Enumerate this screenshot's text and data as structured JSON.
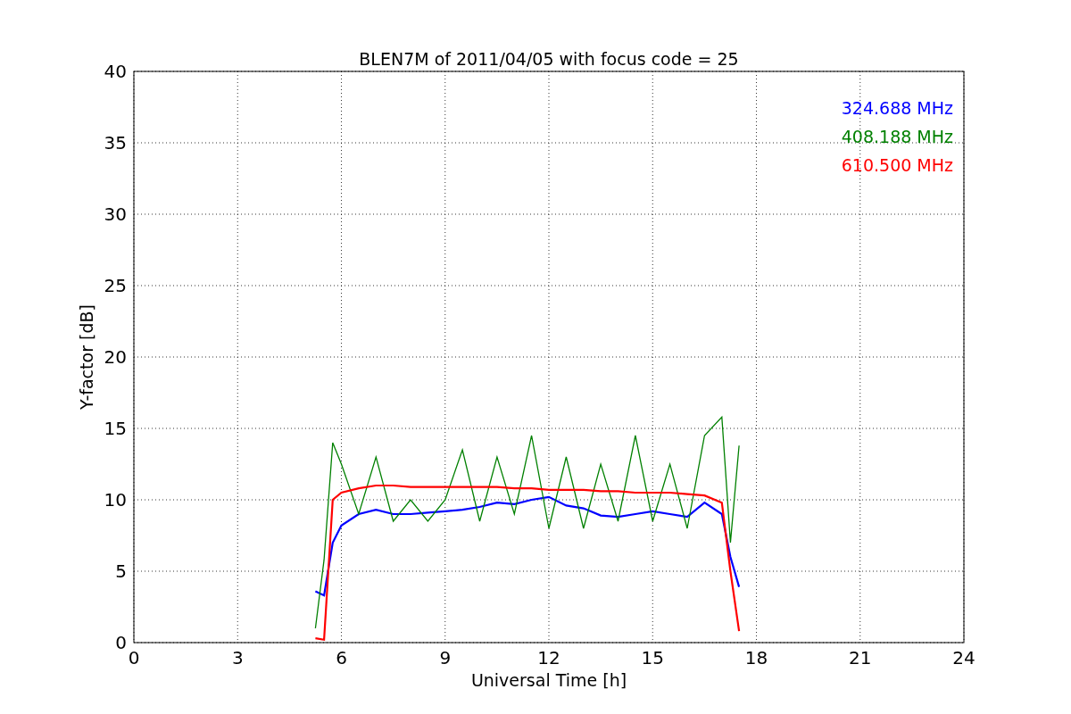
{
  "chart_data": {
    "type": "line",
    "title": "BLEN7M of 2011/04/05 with focus code = 25",
    "xlabel": "Universal Time [h]",
    "ylabel": "Y-factor [dB]",
    "x": [
      5.25,
      5.5,
      5.75,
      6,
      6.5,
      7,
      7.5,
      8,
      8.5,
      9,
      9.5,
      10,
      10.5,
      11,
      11.5,
      12,
      12.5,
      13,
      13.5,
      14,
      14.5,
      15,
      15.5,
      16,
      16.5,
      17,
      17.25,
      17.5
    ],
    "series": [
      {
        "name": "324.688 MHz",
        "color": "#0000ff",
        "values": [
          3.6,
          3.3,
          7,
          8.2,
          9,
          9.3,
          9,
          9,
          9.1,
          9.2,
          9.3,
          9.5,
          9.8,
          9.7,
          10,
          10.2,
          9.6,
          9.4,
          8.9,
          8.8,
          9,
          9.2,
          9,
          8.8,
          9.8,
          9,
          6,
          3.9
        ]
      },
      {
        "name": "408.188 MHz",
        "color": "#008000",
        "values": [
          1,
          5.8,
          14,
          12.5,
          9,
          13,
          8.5,
          10,
          8.5,
          10,
          13.5,
          8.5,
          13,
          9,
          14.5,
          8,
          13,
          8,
          12.5,
          8.5,
          14.5,
          8.5,
          12.5,
          8,
          14.5,
          15.8,
          7,
          13.8
        ]
      },
      {
        "name": "610.500 MHz",
        "color": "#ff0000",
        "values": [
          0.3,
          0.2,
          10,
          10.5,
          10.8,
          11,
          11,
          10.9,
          10.9,
          10.9,
          10.9,
          10.9,
          10.9,
          10.8,
          10.8,
          10.7,
          10.7,
          10.7,
          10.6,
          10.6,
          10.5,
          10.5,
          10.5,
          10.4,
          10.3,
          9.8,
          5,
          0.8
        ]
      }
    ],
    "xlim": [
      0,
      24
    ],
    "ylim": [
      0,
      40
    ],
    "xticks": [
      0,
      3,
      6,
      9,
      12,
      15,
      18,
      21,
      24
    ],
    "yticks": [
      0,
      5,
      10,
      15,
      20,
      25,
      30,
      35,
      40
    ],
    "grid": true
  }
}
